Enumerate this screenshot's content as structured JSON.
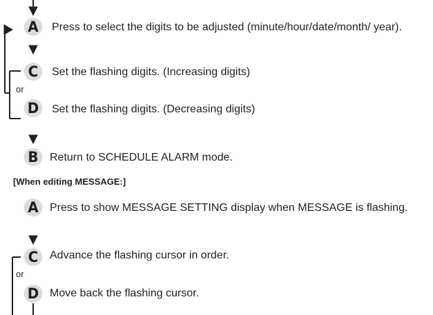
{
  "instructions": {
    "step_a1": {
      "key": "A",
      "text": "Press to select the digits to be adjusted (minute/hour/date/month/ year)."
    },
    "step_c1": {
      "key": "C",
      "text": "Set the flashing digits. (Increasing digits)"
    },
    "or1": "or",
    "step_d1": {
      "key": "D",
      "text": "Set the flashing digits. (Decreasing digits)"
    },
    "step_b1": {
      "key": "B",
      "text": "Return to SCHEDULE ALARM mode."
    },
    "message_heading": "[When editing MESSAGE:]",
    "step_a2": {
      "key": "A",
      "text": "Press to show MESSAGE SETTING display when MESSAGE is flashing."
    },
    "step_c2": {
      "key": "C",
      "text": "Advance the flashing cursor in order."
    },
    "or2": "or",
    "step_d2": {
      "key": "D",
      "text": "Move back the flashing cursor."
    }
  }
}
